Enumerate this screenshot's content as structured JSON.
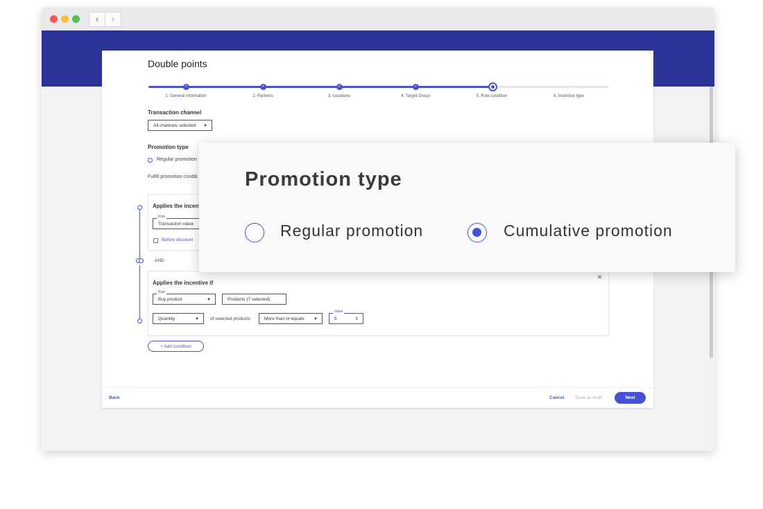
{
  "browser": {
    "back_glyph": "‹",
    "forward_glyph": "›"
  },
  "page": {
    "title": "Double points"
  },
  "stepper": {
    "steps": [
      "1. General information",
      "2. Partners",
      "3. Locations",
      "4. Target Group",
      "5. Rule condition",
      "6. Incentive type"
    ],
    "current_step": 5
  },
  "transaction": {
    "label": "Transaction channel",
    "select_value": "All channels selected"
  },
  "promotion": {
    "label": "Promotion type",
    "regular_label": "Regular promotion",
    "fulfill_text": "Fulfill promotion conditi"
  },
  "condition1": {
    "title": "Applies the incent",
    "rule_label": "Rule",
    "rule_value": "Transaction value",
    "checkbox_label": "Before discount"
  },
  "and_label": "AND",
  "condition2": {
    "title": "Applies the incentive if",
    "close_glyph": "×",
    "rule_label": "Rule",
    "rule_value": "Buy product",
    "products_value": "Products (7 selected)",
    "quantity_value": "Quantity",
    "of_selected": "of selected products",
    "comparator_value": "More than or equals",
    "value_label": "Value",
    "value": "5"
  },
  "add_condition": "+ Add condition",
  "footer": {
    "back": "Back",
    "cancel": "Cancel",
    "save_draft": "Save as draft",
    "next": "Next"
  },
  "popup": {
    "title": "Promotion type",
    "options": [
      {
        "label": "Regular promotion",
        "selected": false
      },
      {
        "label": "Cumulative promotion",
        "selected": true
      }
    ]
  },
  "colors": {
    "brand_blue": "#2b3396",
    "accent": "#4453d6"
  }
}
